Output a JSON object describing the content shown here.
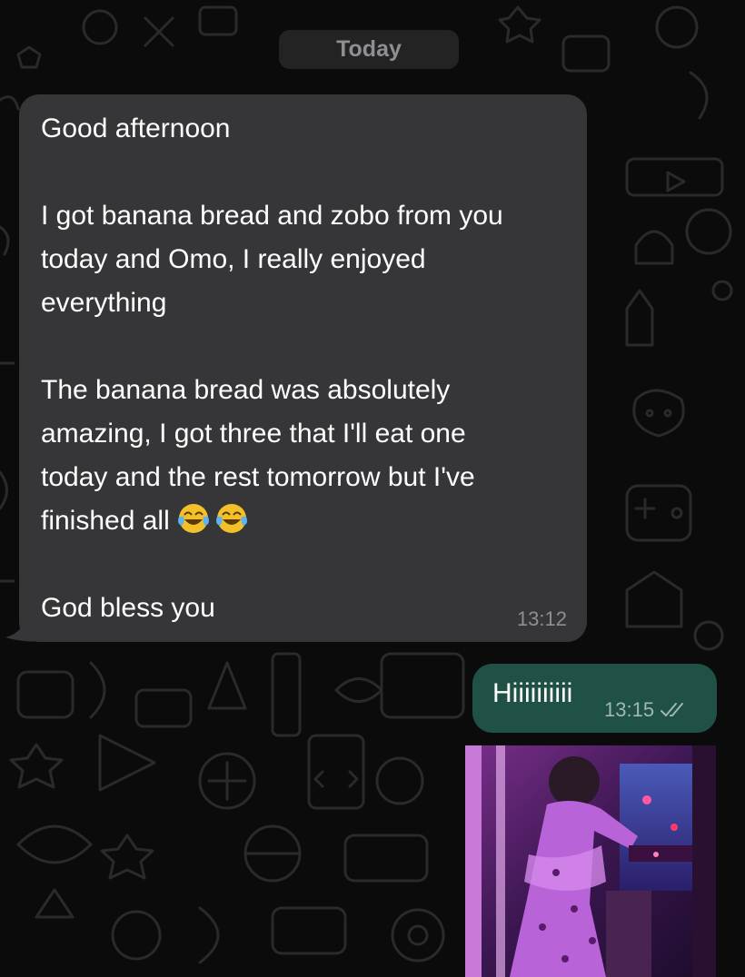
{
  "chat": {
    "date_separator": "Today",
    "incoming": {
      "lines": [
        "Good afternoon",
        "",
        "I got banana bread and zobo from you",
        "today and Omo, I really enjoyed",
        "everything",
        "",
        "The banana bread was absolutely",
        "amazing, I got three that I'll eat one",
        "today and the rest tomorrow but I've",
        "finished all",
        "",
        "God bless you"
      ],
      "emoji": [
        "face-with-tears-of-joy-icon",
        "face-with-tears-of-joy-icon"
      ],
      "time": "13:12"
    },
    "outgoing": {
      "text": "Hiiiiiiiiii",
      "time": "13:15",
      "status_icon": "double-check-read-icon"
    },
    "media": {
      "type": "video-thumbnail"
    }
  },
  "colors": {
    "background": "#0b0b0b",
    "incoming_bubble": "#363638",
    "outgoing_bubble": "#1f5146",
    "timestamp": "#8e8e93",
    "chip": "#232323"
  }
}
